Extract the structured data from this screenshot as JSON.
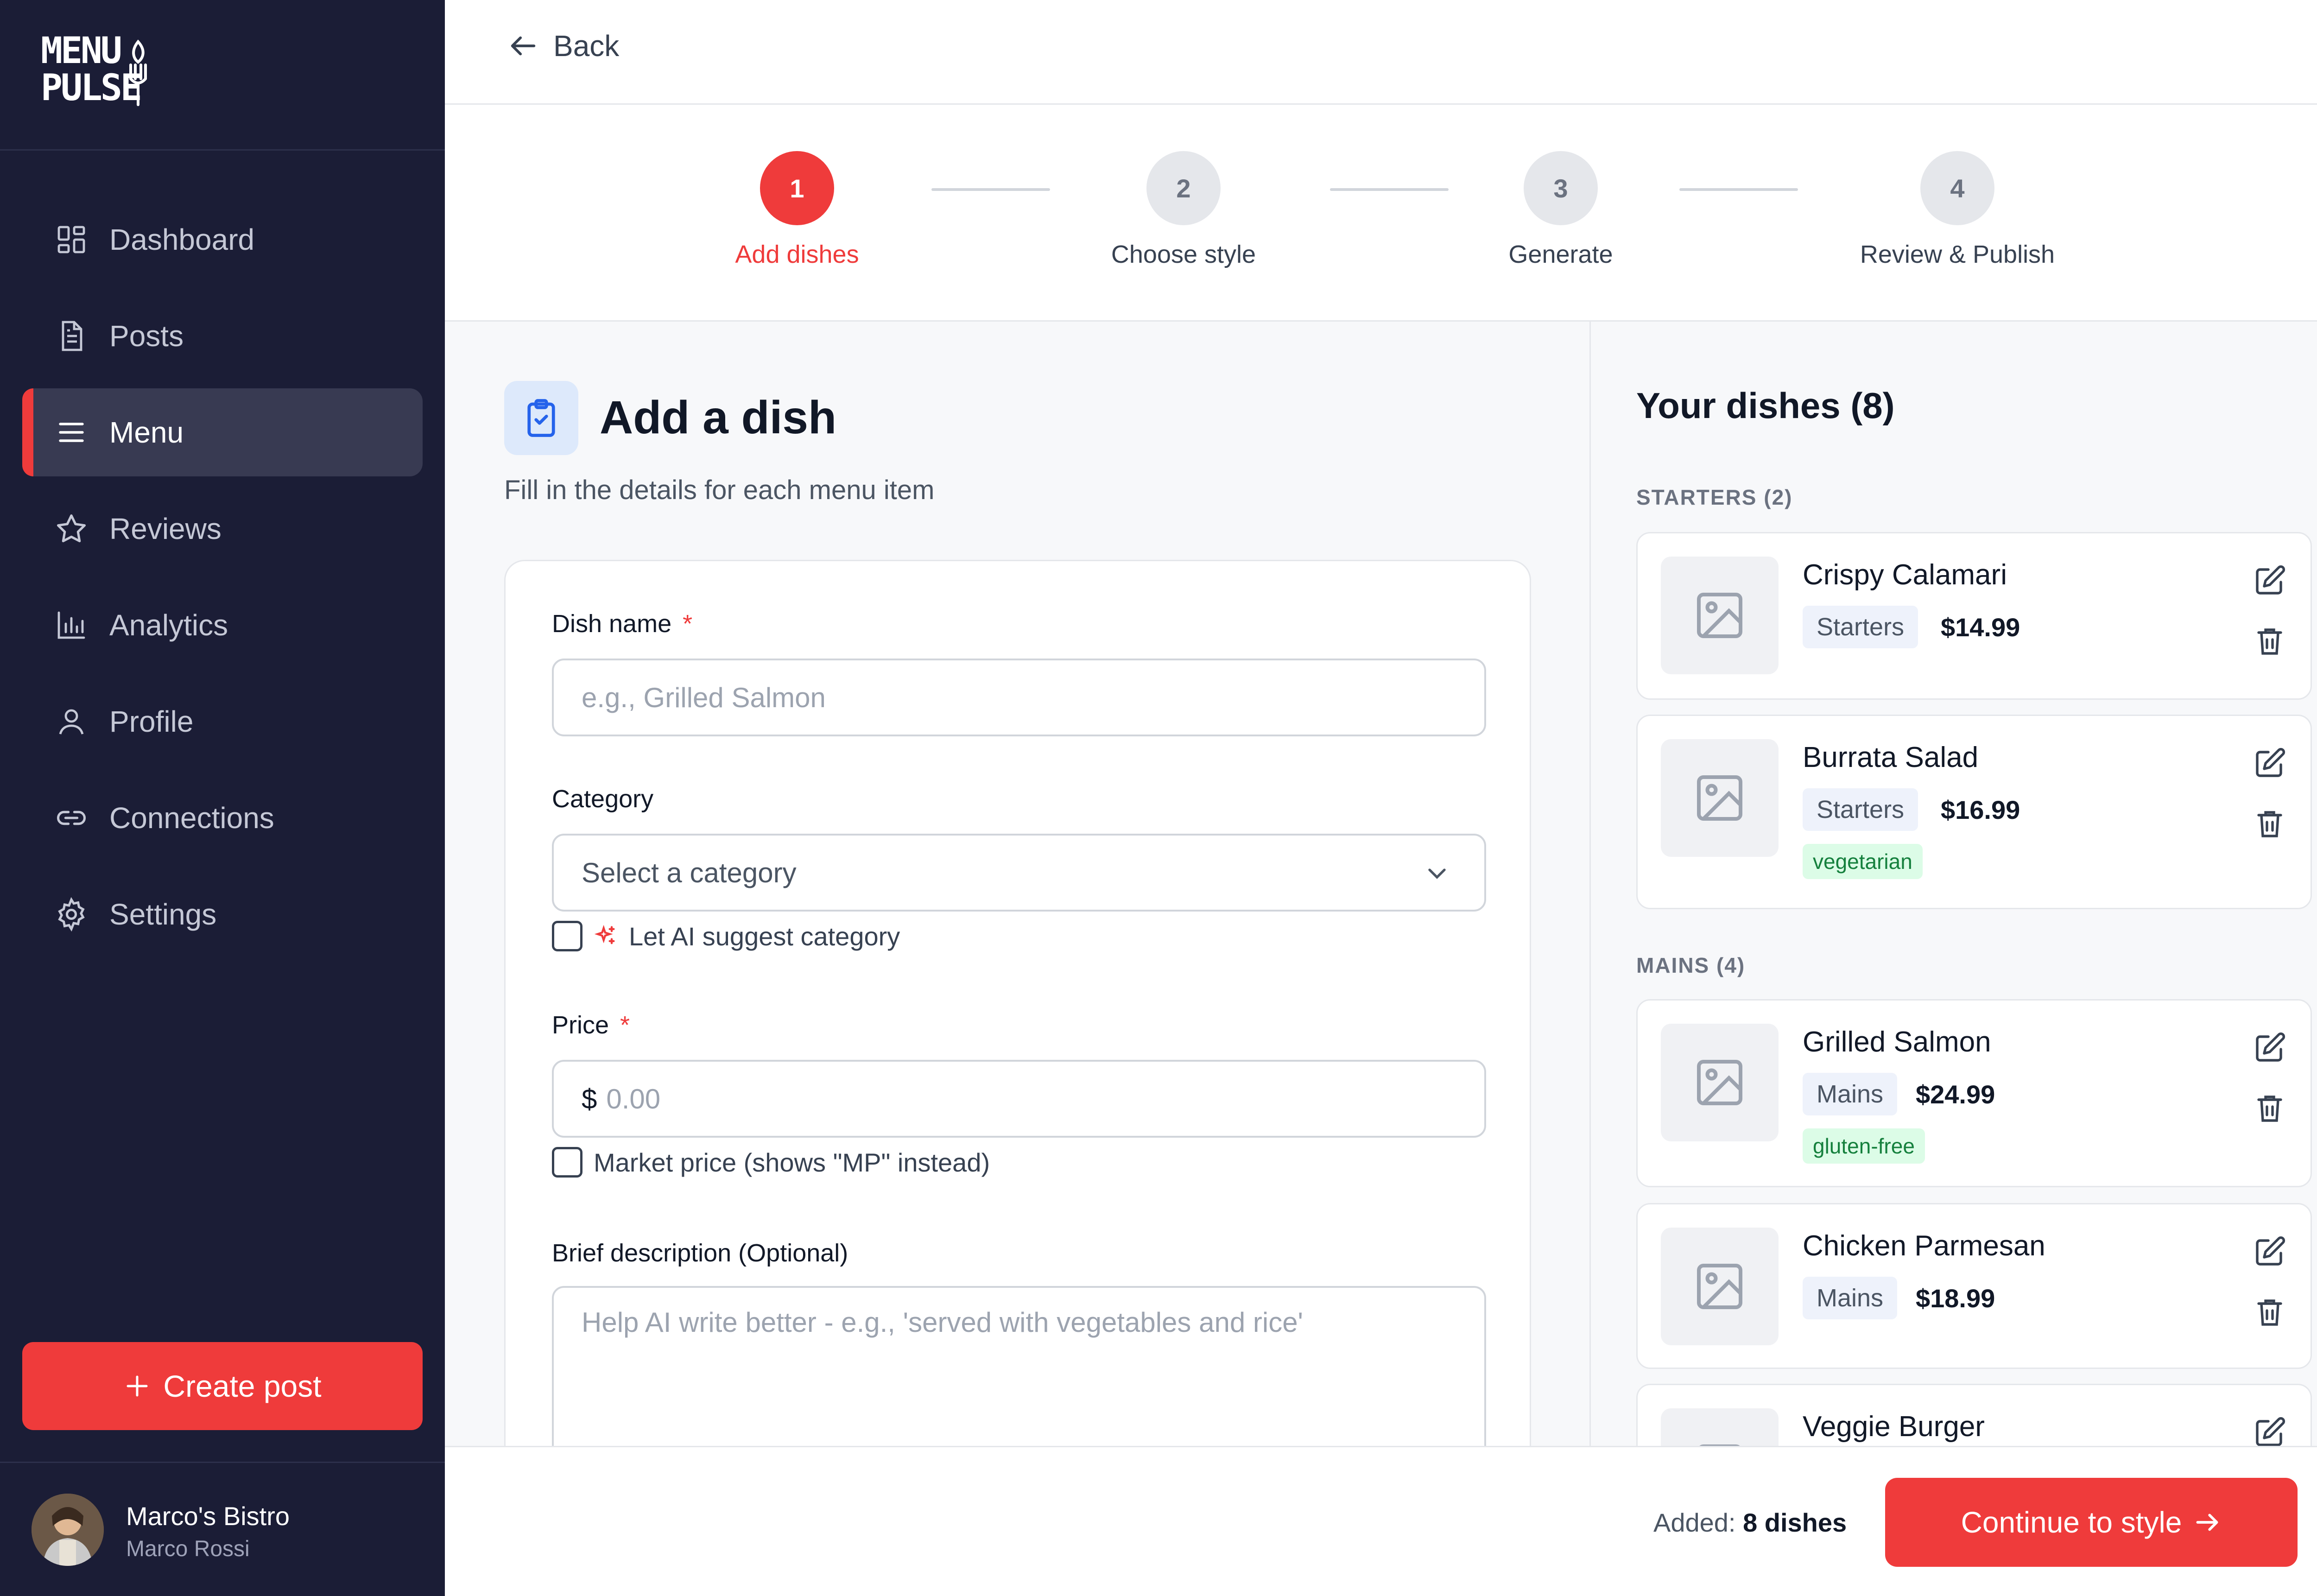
{
  "brand": {
    "line1": "MENU",
    "line2": "PULSE"
  },
  "sidebar": {
    "items": [
      {
        "label": "Dashboard",
        "icon": "dashboard-grid-icon"
      },
      {
        "label": "Posts",
        "icon": "document-icon"
      },
      {
        "label": "Menu",
        "icon": "hamburger-menu-icon",
        "active": true
      },
      {
        "label": "Reviews",
        "icon": "star-icon"
      },
      {
        "label": "Analytics",
        "icon": "bar-chart-icon"
      },
      {
        "label": "Profile",
        "icon": "user-icon"
      },
      {
        "label": "Connections",
        "icon": "link-icon"
      },
      {
        "label": "Settings",
        "icon": "gear-icon"
      }
    ],
    "create_label": "Create post",
    "user": {
      "name": "Marco's Bistro",
      "sub": "Marco Rossi"
    }
  },
  "topbar": {
    "back_label": "Back"
  },
  "stepper": {
    "steps": [
      {
        "number": "1",
        "label": "Add dishes",
        "active": true
      },
      {
        "number": "2",
        "label": "Choose style"
      },
      {
        "number": "3",
        "label": "Generate"
      },
      {
        "number": "4",
        "label": "Review & Publish"
      }
    ]
  },
  "form": {
    "title": "Add a dish",
    "subtitle": "Fill in the details for each menu item",
    "dish_name_label": "Dish name",
    "dish_name_placeholder": "e.g., Grilled Salmon",
    "required_mark": "*",
    "category_label": "Category",
    "category_value": "Select a category",
    "ai_suggest_label": "Let AI suggest category",
    "price_label": "Price",
    "currency": "$",
    "price_placeholder": "0.00",
    "market_price_label": "Market price (shows \"MP\" instead)",
    "description_label": "Brief description (Optional)",
    "description_placeholder": "Help AI write better - e.g., 'served with vegetables and rice'"
  },
  "dishes": {
    "title": "Your dishes (8)",
    "sections": [
      {
        "label": "STARTERS (2)",
        "items": [
          {
            "name": "Crispy Calamari",
            "category": "Starters",
            "price": "$14.99"
          },
          {
            "name": "Burrata Salad",
            "category": "Starters",
            "price": "$16.99",
            "tag": "vegetarian"
          }
        ]
      },
      {
        "label": "MAINS (4)",
        "items": [
          {
            "name": "Grilled Salmon",
            "category": "Mains",
            "price": "$24.99",
            "tag": "gluten-free"
          },
          {
            "name": "Chicken Parmesan",
            "category": "Mains",
            "price": "$18.99"
          },
          {
            "name": "Veggie Burger"
          }
        ]
      }
    ]
  },
  "footer": {
    "added_prefix": "Added:",
    "added_count": "8 dishes",
    "continue_label": "Continue to style"
  },
  "colors": {
    "accent": "#ef3b3b",
    "sidebar_bg": "#1b1d36",
    "tag_green": "#15803d"
  }
}
